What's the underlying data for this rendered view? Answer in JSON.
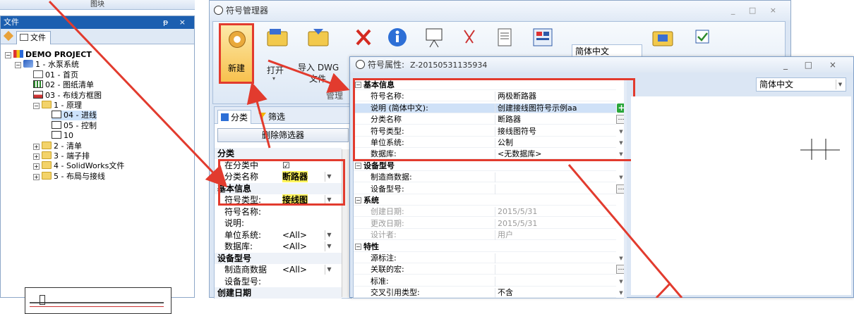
{
  "top_strip": {
    "label": "图块"
  },
  "file_panel": {
    "title": "文件",
    "pin": "ᵽ ×",
    "tab": "文件",
    "tree": [
      {
        "label": "DEMO PROJECT",
        "icon": "project-icon"
      },
      {
        "label": "1 - 水泵系统",
        "icon": "system-icon"
      },
      {
        "label": "01 - 首页",
        "icon": "page-icon"
      },
      {
        "label": "02 - 图纸清单",
        "icon": "grid-page-icon"
      },
      {
        "label": "03 - 布线方框图",
        "icon": "diagram-icon"
      },
      {
        "label": "1 - 原理",
        "icon": "folder-icon"
      },
      {
        "label": "04 - 进线",
        "icon": "sheet-icon"
      },
      {
        "label": "05 - 控制",
        "icon": "sheet-icon"
      },
      {
        "label": "10",
        "icon": "sheet-icon"
      },
      {
        "label": "2 - 清单",
        "icon": "folder-icon"
      },
      {
        "label": "3 - 端子排",
        "icon": "folder-icon"
      },
      {
        "label": "4 - SolidWorks文件",
        "icon": "folder-icon"
      },
      {
        "label": "5 - 布局与接线",
        "icon": "folder-icon"
      }
    ]
  },
  "symbol_manager": {
    "title": "符号管理器",
    "window_controls": "_ □ ×",
    "ribbon": {
      "new": "新建",
      "open": "打开",
      "import_dwg": "导入 DWG",
      "file": "文件",
      "group_label": "管理",
      "language": "简体中文"
    },
    "filter_panel": {
      "tab_class": "分类",
      "tab_filter": "筛选",
      "delete_filter": "删除筛选器",
      "rows": [
        {
          "type": "cat",
          "label": "分类"
        },
        {
          "type": "row",
          "label": "在分类中",
          "value": "☑"
        },
        {
          "type": "row",
          "label": "分类名称",
          "value": "断路器",
          "highlight": true
        },
        {
          "type": "cat",
          "label": "基本信息"
        },
        {
          "type": "row",
          "label": "符号类型:",
          "value": "接线图",
          "highlight": true
        },
        {
          "type": "row",
          "label": "符号名称:",
          "value": ""
        },
        {
          "type": "row",
          "label": "说明:",
          "value": ""
        },
        {
          "type": "row",
          "label": "单位系统:",
          "value": "<All>"
        },
        {
          "type": "row",
          "label": "数据库:",
          "value": "<All>"
        },
        {
          "type": "cat",
          "label": "设备型号"
        },
        {
          "type": "row",
          "label": "制造商数据",
          "value": "<All>"
        },
        {
          "type": "row",
          "label": "设备型号:",
          "value": ""
        },
        {
          "type": "cat",
          "label": "创建日期"
        }
      ]
    }
  },
  "properties": {
    "title": "符号属性:",
    "id": "Z-20150531135934",
    "window_controls": "_ □ ×",
    "language": "简体中文",
    "rows": [
      {
        "type": "cat",
        "label": "基本信息"
      },
      {
        "type": "row",
        "label": "符号名称:",
        "value": "两极断路器"
      },
      {
        "type": "row",
        "label": "说明 (简体中文):",
        "value": "创建接线图符号示例aa",
        "selected": true,
        "button": "plus"
      },
      {
        "type": "row",
        "label": "分类名称",
        "value": "断路器",
        "button": "ellipsis"
      },
      {
        "type": "row",
        "label": "符号类型:",
        "value": "接线图符号",
        "dropdown": true
      },
      {
        "type": "row",
        "label": "单位系统:",
        "value": "公制",
        "dropdown": true
      },
      {
        "type": "row",
        "label": "数据库:",
        "value": "<无数据库>",
        "dropdown": true
      },
      {
        "type": "cat",
        "label": "设备型号"
      },
      {
        "type": "row",
        "label": "制造商数据:",
        "value": "",
        "dropdown": true
      },
      {
        "type": "row",
        "label": "设备型号:",
        "value": "",
        "button": "ellipsis"
      },
      {
        "type": "cat",
        "label": "系统"
      },
      {
        "type": "row",
        "label": "创建日期:",
        "value": "2015/5/31",
        "disabled": true
      },
      {
        "type": "row",
        "label": "更改日期:",
        "value": "2015/5/31",
        "disabled": true
      },
      {
        "type": "row",
        "label": "设计者:",
        "value": "用户",
        "disabled": true
      },
      {
        "type": "cat",
        "label": "特性"
      },
      {
        "type": "row",
        "label": "源标注:",
        "value": "",
        "dropdown": true
      },
      {
        "type": "row",
        "label": "关联的宏:",
        "value": "",
        "button": "ellipsis"
      },
      {
        "type": "row",
        "label": "标准:",
        "value": "",
        "dropdown": true
      },
      {
        "type": "row",
        "label": "交叉引用类型:",
        "value": "不含",
        "dropdown": true
      }
    ]
  },
  "colors": {
    "highlight_red": "#e23b2e",
    "accent_blue": "#1c5fb0"
  }
}
